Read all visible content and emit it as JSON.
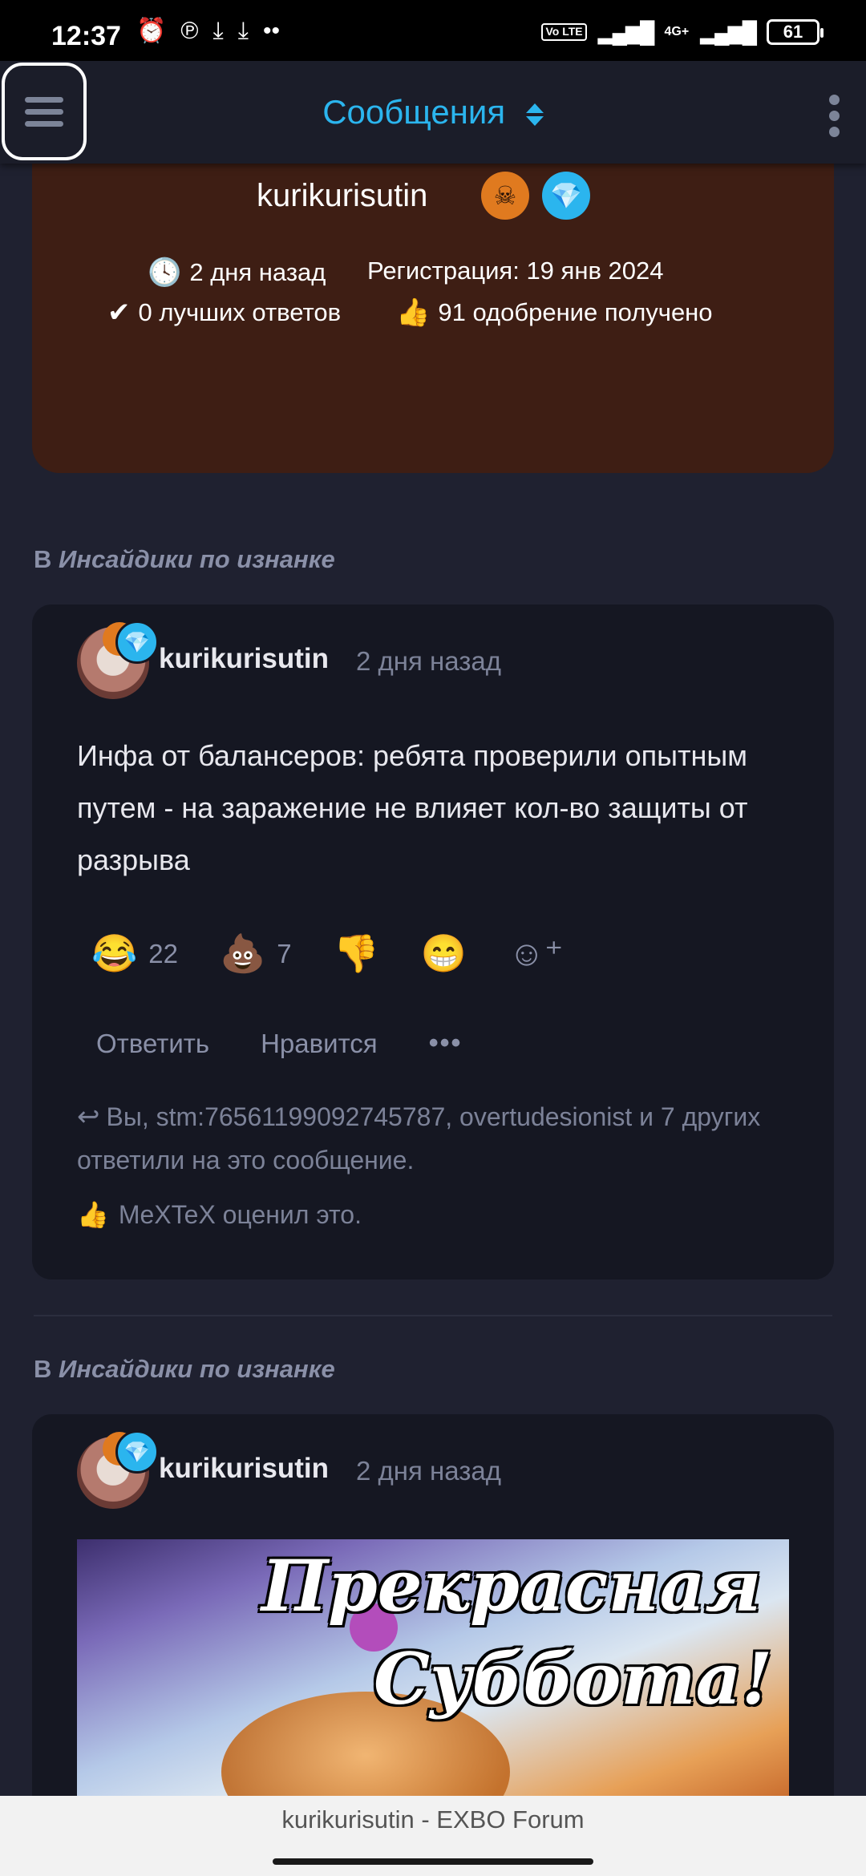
{
  "status_bar": {
    "time": "12:37",
    "icons": [
      "alarm-icon",
      "pinterest-icon",
      "download-icon",
      "download-icon",
      "more-dots-icon"
    ],
    "volte": "Vo LTE",
    "network": "4G+",
    "battery": "61"
  },
  "header": {
    "title": "Сообщения"
  },
  "profile": {
    "username": "kurikurisutin",
    "last_seen": "2 дня назад",
    "registration": "Регистрация: 19 янв 2024",
    "best_answers": "0 лучших ответов",
    "likes_received": "91 одобрение получено"
  },
  "posts": [
    {
      "section_prefix": "В",
      "section_name": "Инсайдики по изнанке",
      "author": "kurikurisutin",
      "time": "2 дня назад",
      "text": "Инфа от балансеров: ребята проверили опытным путем - на заражение не влияет кол-во защиты от разрыва",
      "reactions": [
        {
          "emoji": "😂",
          "count": "22"
        },
        {
          "emoji": "💩",
          "count": "7"
        },
        {
          "emoji": "👎",
          "count": ""
        },
        {
          "emoji": "😁",
          "count": ""
        }
      ],
      "reply_label": "Ответить",
      "like_label": "Нравится",
      "more_label": "•••",
      "replied_info": "Вы, stm:76561199092745787, overtudesionist и 7 других ответили на это сообщение.",
      "liked_info": "MeXTeX оценил это."
    },
    {
      "section_prefix": "В",
      "section_name": "Инсайдики по изнанке",
      "author": "kurikurisutin",
      "time": "2 дня назад",
      "image_text_line1": "Прекрасная",
      "image_text_line2": "Суббота!"
    }
  ],
  "bottom_bar": {
    "title": "kurikurisutin - EXBO Forum"
  }
}
